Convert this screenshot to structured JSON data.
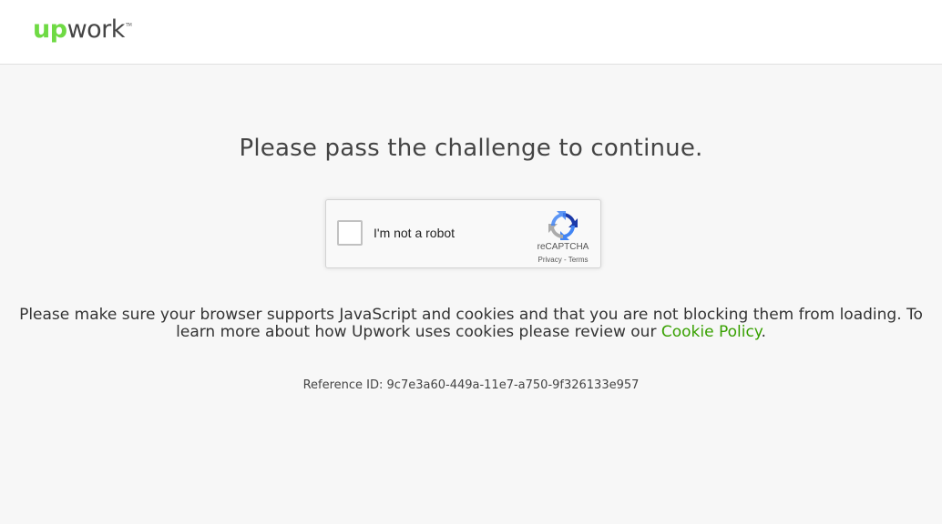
{
  "header": {
    "logo": {
      "up": "up",
      "work": "work",
      "tm": "TM"
    }
  },
  "main": {
    "title": "Please pass the challenge to continue.",
    "captcha": {
      "checkbox_label": "I'm not a robot",
      "brand": "reCAPTCHA",
      "privacy_link": "Privacy",
      "separator": " - ",
      "terms_link": "Terms",
      "icon": "recaptcha-icon"
    },
    "info": {
      "text_part1": "Please make sure your browser supports JavaScript and cookies and that you are not blocking them from loading. To learn more about how Upwork uses cookies please review our ",
      "link_text": "Cookie Policy",
      "text_part2": "."
    },
    "reference": "Reference ID: 9c7e3a60-449a-11e7-a750-9f326133e957"
  },
  "colors": {
    "brand_green": "#6fda44",
    "link_green": "#37a000",
    "background": "#f7f7f7"
  }
}
